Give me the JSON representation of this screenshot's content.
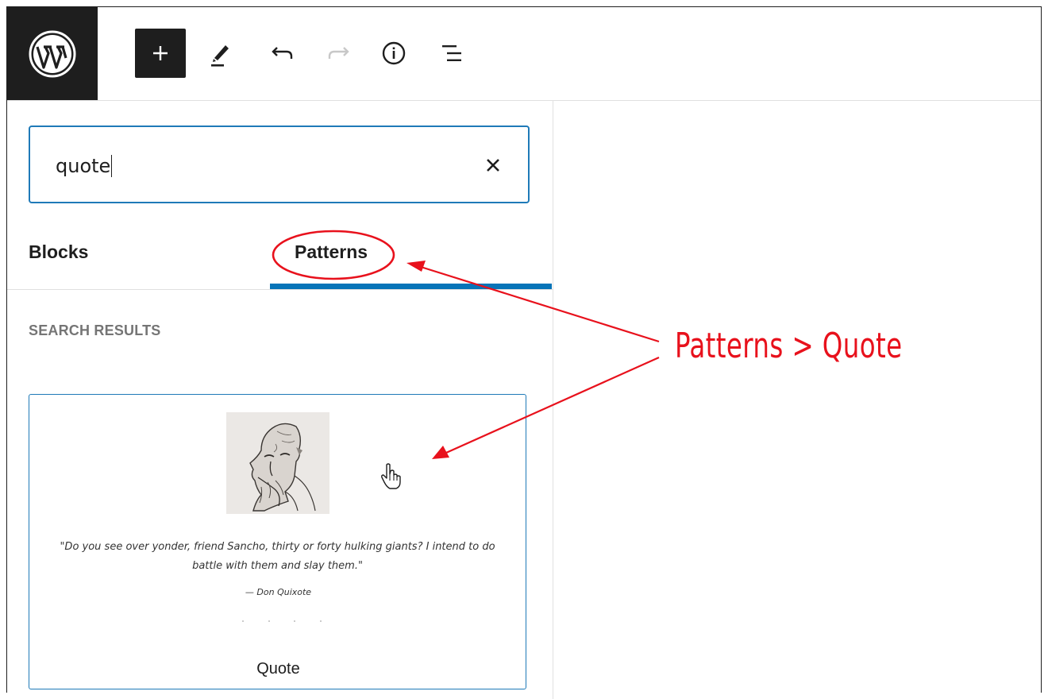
{
  "toolbar": {
    "logo_icon": "wordpress-logo",
    "inserter_icon": "plus-icon",
    "tools_icon": "pencil-icon",
    "undo_icon": "undo-icon",
    "redo_icon": "redo-icon",
    "info_icon": "info-icon",
    "list_view_icon": "list-view-icon"
  },
  "search": {
    "value": "quote",
    "clear_icon": "close-icon"
  },
  "tabs": [
    {
      "label": "Blocks",
      "selected": false
    },
    {
      "label": "Patterns",
      "selected": true
    }
  ],
  "results": {
    "section_label": "SEARCH RESULTS",
    "patterns": [
      {
        "title": "Quote",
        "quote": "\"Do you see over yonder, friend Sancho, thirty or forty hulking giants? I intend to do battle with them and slay them.\"",
        "citation": "— Don Quixote"
      }
    ]
  },
  "annotation": {
    "label": "Patterns > Quote",
    "color": "#e8111c"
  },
  "colors": {
    "accent": "#0774b8",
    "dark": "#1e1e1e"
  }
}
